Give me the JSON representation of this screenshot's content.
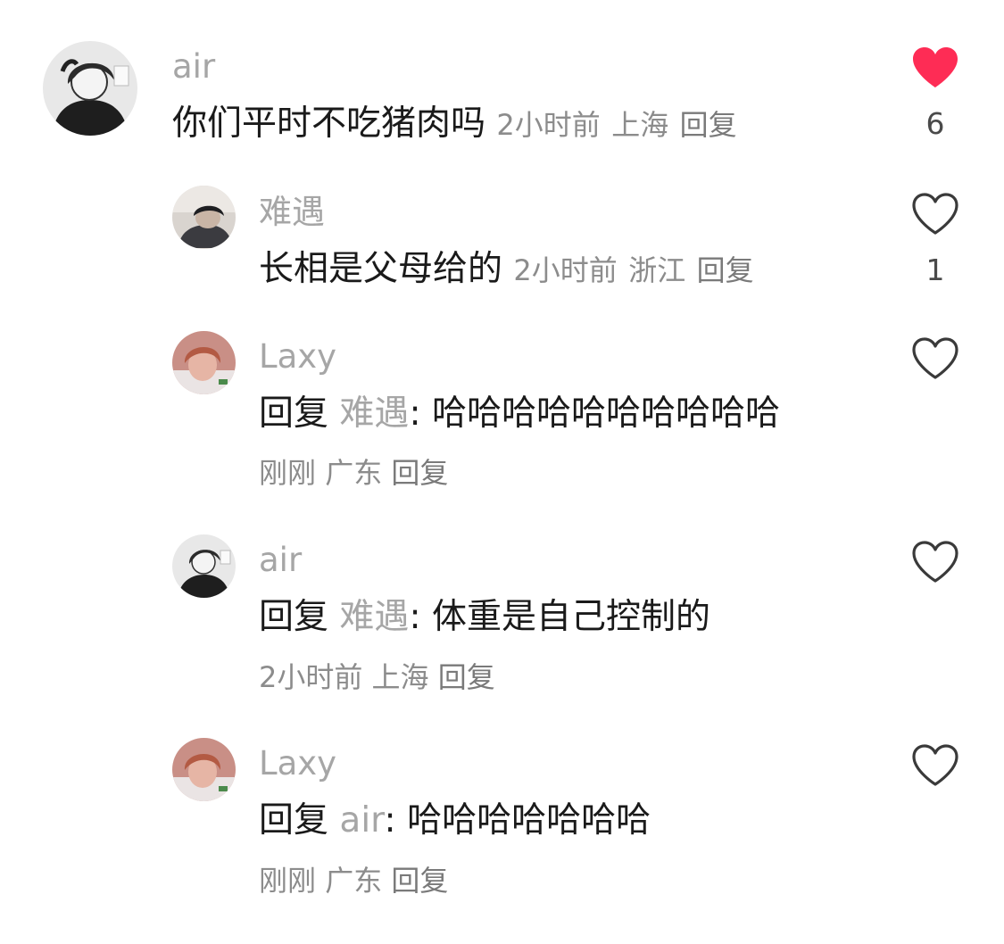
{
  "colors": {
    "liked": "#fe2c55",
    "icon_outline": "#3a3a3a",
    "muted": "#8c8c8c"
  },
  "comments": [
    {
      "username": "air",
      "text": "你们平时不吃猪肉吗",
      "time": "2小时前",
      "location": "上海",
      "reply_label": "回复",
      "likes": "6",
      "liked": true
    },
    {
      "username": "难遇",
      "text": "长相是父母给的",
      "time": "2小时前",
      "location": "浙江",
      "reply_label": "回复",
      "likes": "1",
      "liked": false
    },
    {
      "username": "Laxy",
      "reply_prefix": "回复",
      "reply_to": "难遇",
      "colon": ":",
      "text": "哈哈哈哈哈哈哈哈哈哈",
      "time": "刚刚",
      "location": "广东",
      "reply_label": "回复",
      "liked": false
    },
    {
      "username": "air",
      "reply_prefix": "回复",
      "reply_to": "难遇",
      "colon": ":",
      "text": "体重是自己控制的",
      "time": "2小时前",
      "location": "上海",
      "reply_label": "回复",
      "liked": false
    },
    {
      "username": "Laxy",
      "reply_prefix": "回复",
      "reply_to": "air",
      "colon": ":",
      "text": "哈哈哈哈哈哈哈",
      "time": "刚刚",
      "location": "广东",
      "reply_label": "回复",
      "liked": false
    }
  ]
}
